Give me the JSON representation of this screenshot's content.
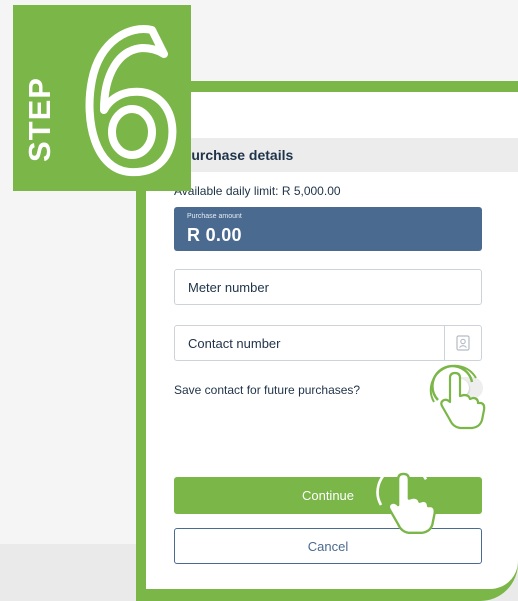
{
  "badge": {
    "step_word": "STEP",
    "step_number": "6"
  },
  "form": {
    "section_title": "Purchase details",
    "limit_text": "Available daily limit: R 5,000.00",
    "amount_label": "Purchase amount",
    "amount_value": "R 0.00",
    "meter_placeholder": "Meter number",
    "contact_placeholder": "Contact number",
    "save_contact_label": "Save contact for future purchases?",
    "save_contact_enabled": false,
    "continue_label": "Continue",
    "cancel_label": "Cancel"
  },
  "colors": {
    "brand_green": "#7ab648",
    "navy": "#4b6a8f",
    "text": "#1f3349"
  }
}
